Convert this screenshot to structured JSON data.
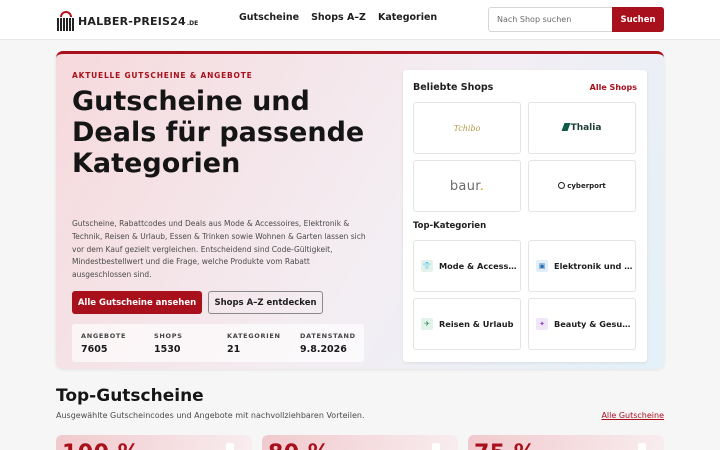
{
  "header": {
    "logo_text": "HALBER-PREIS24",
    "logo_tld": ".DE",
    "nav": [
      "Gutscheine",
      "Shops A–Z",
      "Kategorien"
    ],
    "search_placeholder": "Nach Shop suchen",
    "search_button": "Suchen"
  },
  "hero": {
    "eyebrow": "AKTUELLE GUTSCHEINE & ANGEBOTE",
    "title": "Gutscheine und Deals für passende Kategorien",
    "text": "Gutscheine, Rabattcodes und Deals aus Mode & Accessoires, Elektronik & Technik, Reisen & Urlaub, Essen & Trinken sowie Wohnen & Garten lassen sich vor dem Kauf gezielt vergleichen. Entscheidend sind Code-Gültigkeit, Mindestbestellwert und die Frage, welche Produkte vom Rabatt ausgeschlossen sind.",
    "primary_button": "Alle Gutscheine ansehen",
    "secondary_button": "Shops A–Z entdecken",
    "stats": [
      {
        "label": "ANGEBOTE",
        "value": "7605"
      },
      {
        "label": "SHOPS",
        "value": "1530"
      },
      {
        "label": "KATEGORIEN",
        "value": "21"
      },
      {
        "label": "DATENSTAND",
        "value": "9.8.2026"
      }
    ]
  },
  "panel": {
    "title": "Beliebte Shops",
    "link": "Alle Shops",
    "shops": [
      {
        "name": "Tchibo"
      },
      {
        "name": "Thalia"
      },
      {
        "name": "baur"
      },
      {
        "name": "cyberport"
      }
    ],
    "categories_title": "Top-Kategorien",
    "categories": [
      {
        "label": "Mode & Accessoires",
        "icon": "shirt-icon",
        "color": "#2f8a5b",
        "bg": "#e3f3ea"
      },
      {
        "label": "Elektronik und Technik",
        "icon": "chip-icon",
        "color": "#2a6fb0",
        "bg": "#e2eef8"
      },
      {
        "label": "Reisen & Urlaub",
        "icon": "plane-icon",
        "color": "#2f8a5b",
        "bg": "#e3f3ea"
      },
      {
        "label": "Beauty & Gesundheit",
        "icon": "sparkle-icon",
        "color": "#8a4bb8",
        "bg": "#f1e6f8"
      }
    ]
  },
  "top": {
    "title": "Top-Gutscheine",
    "subtitle": "Ausgewählte Gutscheincodes und Angebote mit nachvollziehbaren Vorteilen.",
    "link": "Alle Gutscheine",
    "coupons": [
      {
        "value": "100 %"
      },
      {
        "value": "80 %"
      },
      {
        "value": "75 %"
      }
    ]
  }
}
